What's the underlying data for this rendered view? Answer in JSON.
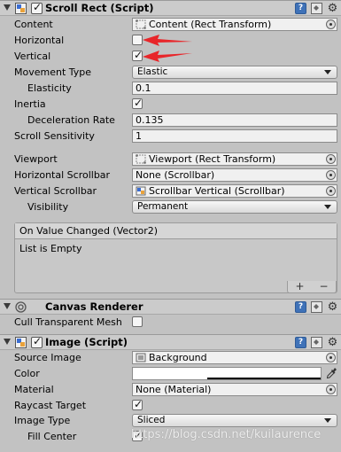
{
  "scroll_rect": {
    "title": "Scroll Rect (Script)",
    "content_label": "Content",
    "content_value": "Content (Rect Transform)",
    "horizontal_label": "Horizontal",
    "horizontal_checked": false,
    "vertical_label": "Vertical",
    "vertical_checked": true,
    "movement_type_label": "Movement Type",
    "movement_type_value": "Elastic",
    "elasticity_label": "Elasticity",
    "elasticity_value": "0.1",
    "inertia_label": "Inertia",
    "inertia_checked": true,
    "deceleration_label": "Deceleration Rate",
    "deceleration_value": "0.135",
    "scroll_sensitivity_label": "Scroll Sensitivity",
    "scroll_sensitivity_value": "1",
    "viewport_label": "Viewport",
    "viewport_value": "Viewport (Rect Transform)",
    "h_scrollbar_label": "Horizontal Scrollbar",
    "h_scrollbar_value": "None (Scrollbar)",
    "v_scrollbar_label": "Vertical Scrollbar",
    "v_scrollbar_value": "Scrollbar Vertical (Scrollbar)",
    "visibility_label": "Visibility",
    "visibility_value": "Permanent",
    "event_header": "On Value Changed (Vector2)",
    "event_body": "List is Empty",
    "plus": "+",
    "minus": "−"
  },
  "canvas_renderer": {
    "title": "Canvas Renderer",
    "cull_label": "Cull Transparent Mesh",
    "cull_checked": false
  },
  "image": {
    "title": "Image (Script)",
    "source_label": "Source Image",
    "source_value": "Background",
    "color_label": "Color",
    "color_value": "#ffffff",
    "material_label": "Material",
    "material_value": "None (Material)",
    "raycast_label": "Raycast Target",
    "raycast_checked": true,
    "image_type_label": "Image Type",
    "image_type_value": "Sliced",
    "fill_center_label": "Fill Center",
    "fill_center_checked": true
  },
  "icons": {
    "help": "?",
    "gear": "⚙",
    "check": "✓"
  },
  "annotation_color": "#e8262a",
  "watermark": "https://blog.csdn.net/kuilaurence"
}
